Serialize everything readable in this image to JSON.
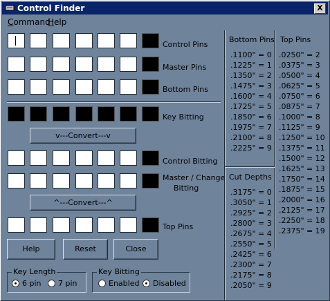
{
  "window": {
    "title": "Control Finder",
    "close": "X"
  },
  "menu": [
    {
      "label": "Command",
      "underline": "C",
      "rest": "ommand"
    },
    {
      "label": "Help",
      "underline": "H",
      "rest": "elp"
    }
  ],
  "rows": {
    "control_pins": "Control Pins",
    "master_pins": "Master Pins",
    "bottom_pins": "Bottom Pins",
    "key_bitting": "Key Bitting",
    "control_bitting": "Control Bitting",
    "master_change_bitting_1": "Master / Change",
    "master_change_bitting_2": "Bitting",
    "top_pins": "Top Pins"
  },
  "buttons": {
    "convert_down": "v---Convert---v",
    "convert_up": "^---Convert---^",
    "help": "Help",
    "reset": "Reset",
    "close": "Close"
  },
  "key_length": {
    "legend": "Key Length",
    "opt1": "6 pin",
    "opt2": "7 pin",
    "selected": "6 pin"
  },
  "key_bitting_opt": {
    "legend": "Key Bitting",
    "opt1": "Enabled",
    "opt2": "Disabled",
    "selected": "Disabled"
  },
  "bottom_pins_table": {
    "header": "Bottom Pins",
    "items": [
      ".1100\" = 0",
      ".1225\" = 1",
      ".1350\" = 2",
      ".1475\" = 3",
      ".1600\" = 4",
      ".1725\" = 5",
      ".1850\" = 6",
      ".1975\" = 7",
      ".2100\" = 8",
      ".2225\" = 9"
    ]
  },
  "cut_depths_table": {
    "header": "Cut Depths",
    "items": [
      ".3175\" = 0",
      ".3050\" = 1",
      ".2925\" = 2",
      ".2800\" = 3",
      ".2675\" = 4",
      ".2550\" = 5",
      ".2425\" = 6",
      ".2300\" = 7",
      ".2175\" = 8",
      ".2050\" = 9"
    ]
  },
  "top_pins_table": {
    "header": "Top Pins",
    "items": [
      ".0250\" = 2",
      ".0375\" = 3",
      ".0500\" = 4",
      ".0625\" = 5",
      ".0750\" = 6",
      ".0875\" = 7",
      ".1000\" = 8",
      ".1125\" = 9",
      ".1250\" = 10",
      ".1375\" = 11",
      ".1500\" = 12",
      ".1625\" = 13",
      ".1750\" = 14",
      ".1875\" = 15",
      ".2000\" = 16",
      ".2125\" = 17",
      ".2250\" = 18",
      ".2375\" = 19"
    ]
  },
  "colors": {
    "background": "#6f839b",
    "titlebar": "#0a246a"
  },
  "icons": {
    "app": "key-icon"
  }
}
